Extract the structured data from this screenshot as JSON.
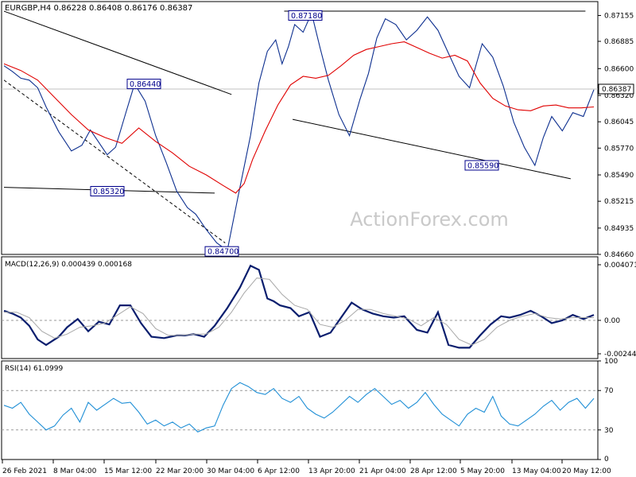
{
  "chart_data": [
    {
      "type": "line",
      "panel": "price",
      "title": "EURGBP,H4  0.86228 0.86408 0.86176 0.86387",
      "symbol": "EURGBP",
      "timeframe": "H4",
      "ohlc": {
        "open": 0.86228,
        "high": 0.86408,
        "low": 0.86176,
        "close": 0.86387
      },
      "last_price_label": "0.86387",
      "watermark": "ActionForex.com",
      "ylim": [
        0.8466,
        0.873
      ],
      "yticks": [
        "0.87155",
        "0.86885",
        "0.86600",
        "0.86320",
        "0.86045",
        "0.85770",
        "0.85490",
        "0.85215",
        "0.84935",
        "0.84660"
      ],
      "xlabels": [
        "26 Feb 2021",
        "8 Mar 04:00",
        "15 Mar 12:00",
        "22 Mar 20:00",
        "30 Mar 04:00",
        "6 Apr 12:00",
        "13 Apr 20:00",
        "21 Apr 04:00",
        "28 Apr 12:00",
        "5 May 20:00",
        "13 May 04:00",
        "20 May 12:00"
      ],
      "annotations": [
        "0.86440",
        "0.85320",
        "0.84700",
        "0.87180",
        "0.85590"
      ],
      "series": [
        {
          "role": "price",
          "x": [
            0,
            4,
            8,
            12,
            16,
            20,
            26,
            32,
            37,
            41,
            45,
            49,
            53,
            58,
            62,
            67,
            72,
            77,
            82,
            87,
            91,
            96,
            101,
            106,
            111,
            117,
            121,
            125,
            129,
            132,
            135,
            138,
            142,
            146,
            150,
            154,
            159,
            164,
            169,
            173,
            177,
            181,
            186,
            191,
            196,
            201,
            206,
            211,
            216,
            221,
            227,
            232,
            237,
            242,
            247,
            252,
            256,
            260,
            265,
            270,
            275,
            280
          ],
          "values": [
            0.8663,
            0.8657,
            0.865,
            0.8648,
            0.864,
            0.862,
            0.8594,
            0.8574,
            0.858,
            0.8596,
            0.8583,
            0.857,
            0.8578,
            0.8615,
            0.8644,
            0.8626,
            0.859,
            0.8562,
            0.8532,
            0.8515,
            0.8508,
            0.8492,
            0.8478,
            0.847,
            0.8525,
            0.859,
            0.8645,
            0.8678,
            0.869,
            0.8665,
            0.8683,
            0.8706,
            0.8698,
            0.8718,
            0.8682,
            0.8648,
            0.8612,
            0.859,
            0.8628,
            0.8655,
            0.8692,
            0.8712,
            0.8706,
            0.869,
            0.87,
            0.8714,
            0.87,
            0.8676,
            0.8652,
            0.864,
            0.8686,
            0.8672,
            0.8642,
            0.8604,
            0.8578,
            0.8559,
            0.8588,
            0.861,
            0.8595,
            0.8614,
            0.861,
            0.8638
          ]
        },
        {
          "role": "moving-average",
          "x": [
            0,
            8,
            16,
            24,
            32,
            40,
            48,
            56,
            64,
            72,
            80,
            88,
            96,
            104,
            110,
            114,
            118,
            124,
            130,
            136,
            142,
            148,
            154,
            160,
            166,
            172,
            178,
            184,
            190,
            196,
            202,
            208,
            214,
            220,
            226,
            232,
            238,
            244,
            250,
            256,
            262,
            268,
            274,
            280
          ],
          "values": [
            0.8665,
            0.8658,
            0.8648,
            0.863,
            0.8612,
            0.8596,
            0.8588,
            0.8582,
            0.8598,
            0.8584,
            0.8572,
            0.8558,
            0.8549,
            0.8538,
            0.853,
            0.854,
            0.8565,
            0.8595,
            0.8622,
            0.8643,
            0.8652,
            0.865,
            0.8653,
            0.8663,
            0.8674,
            0.868,
            0.8683,
            0.8686,
            0.8688,
            0.8682,
            0.8676,
            0.8671,
            0.8674,
            0.8668,
            0.8645,
            0.8629,
            0.8621,
            0.8617,
            0.8616,
            0.8621,
            0.8622,
            0.8619,
            0.8619,
            0.862
          ]
        },
        {
          "role": "trendline",
          "x": [
            0,
            108
          ],
          "values": [
            0.872,
            0.8633
          ]
        },
        {
          "role": "trendline",
          "x": [
            0,
            105
          ],
          "values": [
            0.8648,
            0.8478
          ]
        },
        {
          "role": "trendline",
          "x": [
            0,
            100
          ],
          "values": [
            0.8536,
            0.853
          ]
        },
        {
          "role": "trendline",
          "x": [
            133,
            276
          ],
          "values": [
            0.872,
            0.872
          ]
        },
        {
          "role": "trendline",
          "x": [
            137,
            269
          ],
          "values": [
            0.8607,
            0.8545
          ]
        }
      ]
    },
    {
      "type": "line",
      "panel": "macd",
      "title": "MACD(12,26,9) 0.000439 0.000168",
      "ylim": [
        -0.002445,
        0.004071
      ],
      "yticks": [
        "0.004071",
        "0.00",
        "-0.002445"
      ],
      "series": [
        {
          "role": "macd",
          "x": [
            0,
            4,
            8,
            12,
            16,
            20,
            26,
            30,
            35,
            40,
            45,
            50,
            55,
            60,
            65,
            70,
            76,
            82,
            86,
            90,
            95,
            100,
            106,
            112,
            117,
            121,
            125,
            128,
            131,
            136,
            140,
            145,
            150,
            155,
            160,
            165,
            170,
            175,
            180,
            185,
            190,
            196,
            201,
            206,
            211,
            216,
            221,
            226,
            231,
            236,
            240,
            245,
            250,
            255,
            260,
            265,
            270,
            275,
            280
          ],
          "values": [
            0.0007,
            0.0005,
            0.0002,
            -0.0004,
            -0.0014,
            -0.0018,
            -0.0012,
            -0.0005,
            0.0001,
            -0.0008,
            -0.0001,
            -0.0003,
            0.0011,
            0.0011,
            -0.0002,
            -0.0012,
            -0.0013,
            -0.0011,
            -0.0011,
            -0.001,
            -0.0012,
            -0.0004,
            0.0009,
            0.0024,
            0.004,
            0.0037,
            0.0016,
            0.0014,
            0.0011,
            0.0009,
            0.0003,
            0.0006,
            -0.0012,
            -0.0009,
            0.0002,
            0.0013,
            0.0008,
            0.0005,
            0.0003,
            0.0002,
            0.0003,
            -0.0007,
            -0.0009,
            0.0006,
            -0.0018,
            -0.002,
            -0.002,
            -0.0011,
            -0.0003,
            0.0003,
            0.0002,
            0.0004,
            0.0007,
            0.0003,
            -0.0002,
            0.0,
            0.0004,
            0.0001,
            0.0004
          ]
        },
        {
          "role": "signal",
          "x": [
            0,
            6,
            12,
            18,
            24,
            30,
            36,
            42,
            48,
            54,
            60,
            66,
            72,
            78,
            84,
            90,
            96,
            102,
            108,
            114,
            120,
            126,
            132,
            138,
            144,
            150,
            156,
            162,
            168,
            174,
            180,
            186,
            192,
            198,
            204,
            210,
            216,
            222,
            228,
            234,
            240,
            246,
            252,
            258,
            264,
            270,
            276,
            280
          ],
          "values": [
            0.0006,
            0.0006,
            0.0002,
            -0.0008,
            -0.0013,
            -0.001,
            -0.0005,
            -0.0004,
            -0.0002,
            0.0004,
            0.001,
            0.0005,
            -0.0006,
            -0.0011,
            -0.0011,
            -0.001,
            -0.001,
            -0.0005,
            0.0006,
            0.002,
            0.0031,
            0.003,
            0.0019,
            0.0011,
            0.0008,
            -0.0003,
            -0.0005,
            0.0,
            0.0008,
            0.0008,
            0.0005,
            0.0003,
            0.0001,
            -0.0004,
            0.0002,
            -0.0003,
            -0.0014,
            -0.0018,
            -0.0014,
            -0.0005,
            0.0,
            0.0003,
            0.0005,
            0.0002,
            0.0001,
            0.0002,
            0.0002,
            0.0002
          ]
        }
      ]
    },
    {
      "type": "line",
      "panel": "rsi",
      "title": "RSI(14) 61.0999",
      "ylim": [
        0,
        100
      ],
      "yticks": [
        "100",
        "70",
        "30",
        "0"
      ],
      "series": [
        {
          "role": "rsi",
          "x": [
            0,
            4,
            8,
            12,
            16,
            20,
            24,
            28,
            32,
            36,
            40,
            44,
            48,
            52,
            56,
            60,
            64,
            68,
            72,
            76,
            80,
            84,
            88,
            92,
            96,
            100,
            104,
            108,
            112,
            116,
            120,
            124,
            128,
            132,
            136,
            140,
            144,
            148,
            152,
            156,
            160,
            164,
            168,
            172,
            176,
            180,
            184,
            188,
            192,
            196,
            200,
            204,
            208,
            212,
            216,
            220,
            224,
            228,
            232,
            236,
            240,
            244,
            248,
            252,
            256,
            260,
            264,
            268,
            272,
            276,
            280
          ],
          "values": [
            55,
            52,
            58,
            46,
            38,
            30,
            34,
            45,
            52,
            38,
            58,
            50,
            56,
            62,
            57,
            58,
            48,
            36,
            40,
            34,
            38,
            32,
            36,
            28,
            32,
            34,
            55,
            72,
            78,
            74,
            68,
            66,
            72,
            62,
            58,
            64,
            52,
            46,
            42,
            48,
            56,
            64,
            58,
            66,
            72,
            64,
            56,
            60,
            52,
            58,
            68,
            56,
            46,
            40,
            34,
            46,
            52,
            48,
            64,
            44,
            36,
            34,
            40,
            46,
            54,
            60,
            50,
            58,
            62,
            52,
            62
          ]
        }
      ]
    }
  ]
}
